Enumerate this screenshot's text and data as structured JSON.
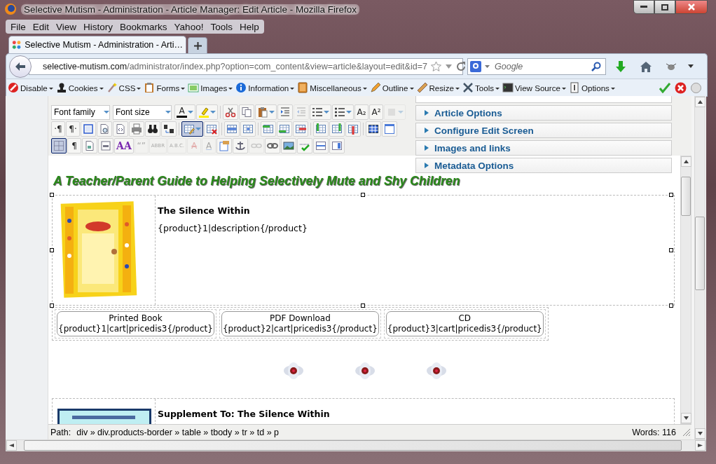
{
  "window": {
    "title": "Selective Mutism - Administration - Article Manager: Edit Article - Mozilla Firefox"
  },
  "menu": [
    "File",
    "Edit",
    "View",
    "History",
    "Bookmarks",
    "Yahoo!",
    "Tools",
    "Help"
  ],
  "tabs": [
    {
      "label": "Selective Mutism - Administration - Arti…",
      "selected": true
    }
  ],
  "address": {
    "host": "selective-mutism.com",
    "path": "/administrator/index.php?option=com_content&view=article&layout=edit&id=7"
  },
  "search": {
    "placeholder": "Google"
  },
  "addons": [
    "Disable",
    "Cookies",
    "CSS",
    "Forms",
    "Images",
    "Information",
    "Miscellaneous",
    "Outline",
    "Resize",
    "Tools",
    "View Source",
    "Options"
  ],
  "editor": {
    "toolbar": [
      [
        {
          "kind": "select",
          "label": "Font family"
        },
        {
          "kind": "select",
          "label": "Font size"
        },
        {
          "kind": "swatch",
          "text": "A",
          "active": false,
          "disabled": false,
          "menu": true
        },
        {
          "kind": "icon",
          "active": false,
          "disabled": false,
          "menu": true
        },
        {
          "kind": "separator"
        },
        {
          "kind": "icon",
          "active": false,
          "disabled": false,
          "menu": false
        },
        {
          "kind": "icon",
          "active": false,
          "disabled": false,
          "menu": false
        },
        {
          "kind": "icon",
          "active": false,
          "disabled": false,
          "menu": true
        },
        {
          "kind": "icon",
          "active": false,
          "disabled": false,
          "menu": false
        },
        {
          "kind": "icon",
          "active": false,
          "disabled": true,
          "menu": false
        },
        {
          "kind": "icon",
          "active": false,
          "disabled": false,
          "menu": true
        },
        {
          "kind": "icon",
          "active": false,
          "disabled": false,
          "menu": true
        },
        {
          "kind": "glyph",
          "text": "A₂",
          "active": false,
          "disabled": false,
          "menu": false
        },
        {
          "kind": "glyph",
          "text": "A²",
          "active": false,
          "disabled": false,
          "menu": false
        },
        {
          "kind": "icon",
          "active": false,
          "disabled": true,
          "menu": true
        }
      ],
      [
        {
          "kind": "glyph",
          "text": "·¶",
          "active": false,
          "disabled": false,
          "menu": false
        },
        {
          "kind": "glyph",
          "text": "¶·",
          "active": false,
          "disabled": false,
          "menu": false
        },
        {
          "kind": "icon",
          "active": false,
          "disabled": false,
          "menu": false
        },
        {
          "kind": "icon",
          "active": false,
          "disabled": false,
          "menu": false
        },
        {
          "kind": "icon",
          "active": false,
          "disabled": false,
          "menu": false
        },
        {
          "kind": "icon",
          "active": false,
          "disabled": false,
          "menu": false
        },
        {
          "kind": "icon",
          "active": false,
          "disabled": false,
          "menu": false
        },
        {
          "kind": "icon",
          "active": false,
          "disabled": false,
          "menu": false
        },
        {
          "kind": "separator"
        },
        {
          "kind": "icon",
          "active": true,
          "disabled": false,
          "menu": true
        },
        {
          "kind": "icon",
          "active": false,
          "disabled": false,
          "menu": false
        },
        {
          "kind": "separator"
        },
        {
          "kind": "icon",
          "active": false,
          "disabled": false,
          "menu": false
        },
        {
          "kind": "icon",
          "active": false,
          "disabled": false,
          "menu": false
        },
        {
          "kind": "separator"
        },
        {
          "kind": "icon",
          "active": false,
          "disabled": false,
          "menu": false
        },
        {
          "kind": "icon",
          "active": false,
          "disabled": false,
          "menu": false
        },
        {
          "kind": "icon",
          "active": false,
          "disabled": false,
          "menu": false
        },
        {
          "kind": "separator"
        },
        {
          "kind": "icon",
          "active": false,
          "disabled": false,
          "menu": false
        },
        {
          "kind": "icon",
          "active": false,
          "disabled": false,
          "menu": false
        },
        {
          "kind": "icon",
          "active": false,
          "disabled": false,
          "menu": false
        },
        {
          "kind": "separator"
        },
        {
          "kind": "icon",
          "active": false,
          "disabled": false,
          "menu": false
        },
        {
          "kind": "icon",
          "active": false,
          "disabled": false,
          "menu": false
        }
      ],
      [
        {
          "kind": "icon",
          "active": true,
          "disabled": false,
          "menu": false
        },
        {
          "kind": "glyph",
          "text": "¶",
          "active": false,
          "disabled": false,
          "menu": false
        },
        {
          "kind": "icon",
          "active": false,
          "disabled": false,
          "menu": false
        },
        {
          "kind": "icon",
          "active": false,
          "disabled": false,
          "menu": false
        },
        {
          "kind": "fancy",
          "text": "AA",
          "active": false,
          "disabled": false,
          "menu": false
        },
        {
          "kind": "glyph",
          "text": "“”",
          "active": false,
          "disabled": true,
          "menu": false
        },
        {
          "kind": "small",
          "text": "ABBR",
          "active": false,
          "disabled": true,
          "menu": false
        },
        {
          "kind": "small",
          "text": "A.B.C.",
          "active": false,
          "disabled": true,
          "menu": false
        },
        {
          "kind": "strike",
          "text": "A",
          "active": false,
          "disabled": true,
          "menu": false
        },
        {
          "kind": "underline",
          "text": "A",
          "active": false,
          "disabled": true,
          "menu": false
        },
        {
          "kind": "icon",
          "active": false,
          "disabled": false,
          "menu": false
        },
        {
          "kind": "icon",
          "active": false,
          "disabled": false,
          "menu": false
        },
        {
          "kind": "icon",
          "active": false,
          "disabled": true,
          "menu": false
        },
        {
          "kind": "icon",
          "active": false,
          "disabled": false,
          "menu": false
        },
        {
          "kind": "icon",
          "active": false,
          "disabled": false,
          "menu": false
        },
        {
          "kind": "icon",
          "active": false,
          "disabled": false,
          "menu": false
        },
        {
          "kind": "icon",
          "active": false,
          "disabled": false,
          "menu": false
        },
        {
          "kind": "icon",
          "active": false,
          "disabled": false,
          "menu": false
        }
      ]
    ],
    "panels": [
      {
        "label": "Article Options",
        "expanded": false
      },
      {
        "label": "Configure Edit Screen",
        "expanded": false
      },
      {
        "label": "Images and links",
        "expanded": false
      },
      {
        "label": "Metadata Options",
        "expanded": false
      }
    ],
    "heading": "A Teacher/Parent Guide to Helping Selectively Mute and Shy Children",
    "product": {
      "title": "The Silence Within",
      "description": "{product}1|description{/product}"
    },
    "buy_options": [
      {
        "label": "Printed Book",
        "code": "{product}1|cart|pricedis3{/product}"
      },
      {
        "label": "PDF Download",
        "code": "{product}2|cart|pricedis3{/product}"
      },
      {
        "label": "CD",
        "code": "{product}3|cart|pricedis3{/product}"
      }
    ],
    "second_product": {
      "title": "Supplement To: The Silence Within"
    },
    "status": {
      "path_label": "Path:",
      "path": "div » div.products-border » table » tbody » tr » td » p",
      "words": "Words: 116"
    }
  }
}
